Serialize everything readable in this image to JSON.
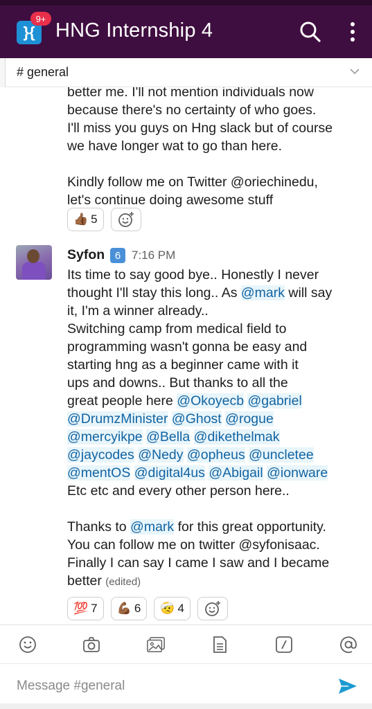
{
  "header": {
    "title": "HNG Internship 4",
    "badge": "9+",
    "app_icon_glyph": "}{",
    "accent": "#3f0e40",
    "icons": [
      "search-icon",
      "more-vertical-icon"
    ]
  },
  "channel": {
    "name": "# general",
    "icon": "chevron-down-icon"
  },
  "messages": [
    {
      "lines": [
        "better me. I'll not mention individuals now",
        "because there's no certainty of who goes.",
        "I'll miss you guys on Hng slack but of course",
        "we have longer wat to go than here.",
        "",
        "Kindly follow me on Twitter @oriechinedu,",
        "let's continue doing awesome stuff"
      ],
      "reactions": [
        {
          "emoji": "👍🏾",
          "count": "5"
        }
      ]
    },
    {
      "author": "Syfon",
      "badge": "6",
      "time": "7:16 PM",
      "lines": [
        "Its time to say good bye.. Honestly I never",
        "thought I'll stay this long.. As ",
        "it, I'm a winner already..",
        "Switching camp from medical field to",
        "programming wasn't gonna be easy and",
        "starting hng as a beginner came with it",
        "ups and downs.. But thanks to all the",
        "great people here ",
        "",
        "",
        "",
        "",
        "Etc etc and every other person here..",
        "",
        "Thanks to ",
        "You can follow me on twitter @syfonisaac.",
        "Finally I can say I came I saw and I became",
        "better "
      ],
      "mentions": {
        "mark": "@mark",
        "will_say": " will say",
        "okoyecb": "@Okoyecb",
        "gabriel": "@gabriel",
        "drumz": "@DrumzMinister",
        "ghost": "@Ghost",
        "rogue": "@rogue",
        "mercy": "@mercyikpe",
        "bella": "@Bella",
        "dike": "@dikethelmak",
        "jay": "@jaycodes",
        "nedy": "@Nedy",
        "opheus": "@opheus",
        "uncletee": "@uncletee",
        "mentos": "@mentOS",
        "digital": "@digital4us",
        "abigail": "@Abigail",
        "ionware": "@ionware",
        "for_opportunity": " for this great opportunity."
      },
      "edited": "(edited)",
      "reactions": [
        {
          "emoji": "💯",
          "count": "7"
        },
        {
          "emoji": "💪🏾",
          "count": "6"
        },
        {
          "emoji": "🤕",
          "count": "4"
        }
      ]
    }
  ],
  "toolbar_icons": [
    "emoji-icon",
    "camera-icon",
    "image-icon",
    "file-icon",
    "slash-command-icon",
    "mention-icon"
  ],
  "composer": {
    "placeholder": "Message #general",
    "send_icon": "send-icon"
  }
}
